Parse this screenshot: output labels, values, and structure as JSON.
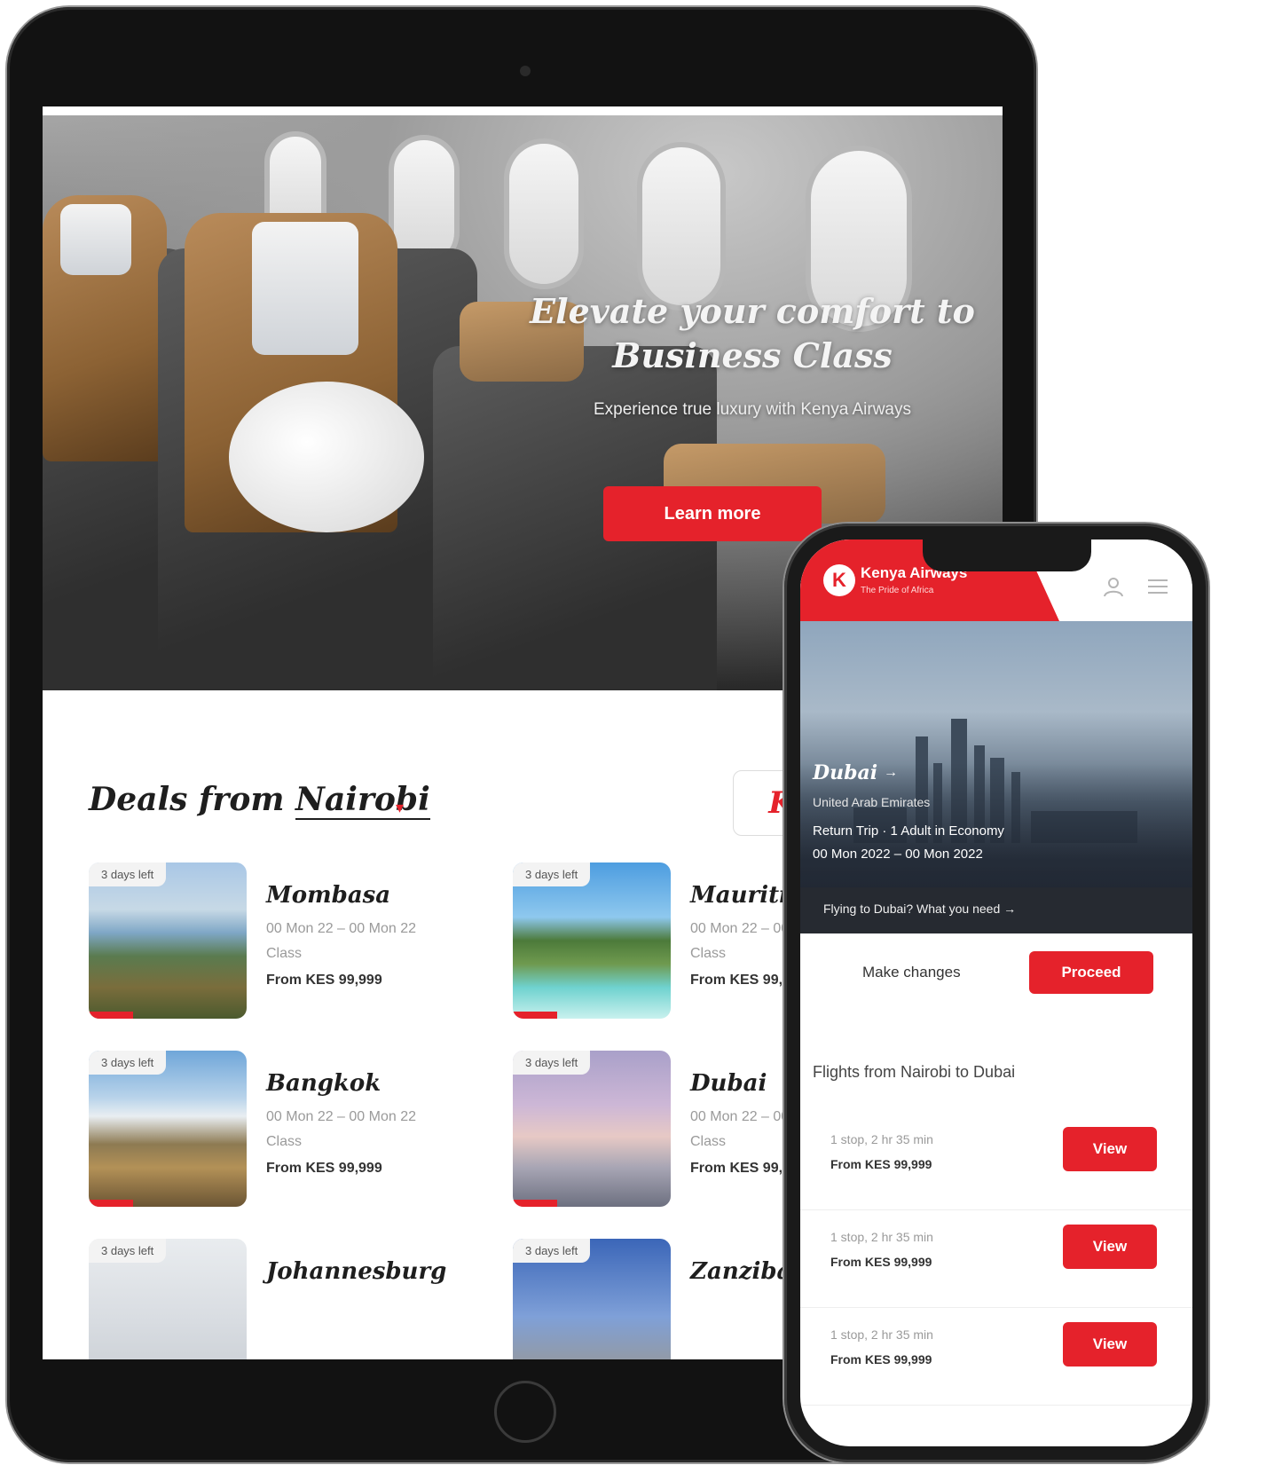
{
  "tablet": {
    "hero": {
      "title": "Elevate your comfort to Business Class",
      "subtitle": "Experience true luxury with Kenya Airways",
      "cta_label": "Learn more"
    },
    "deals": {
      "title_prefix": "Deals from",
      "city": "Nairobi",
      "caret": "▾",
      "badge": "K"
    },
    "deal_cards": [
      {
        "tag": "3 days left",
        "name": "Mombasa",
        "dates": "00 Mon 22 – 00 Mon 22",
        "class": "Class",
        "price": "From KES 99,999"
      },
      {
        "tag": "3 days left",
        "name": "Mauritius",
        "dates": "00 Mon 22 – 00 Mon 22",
        "class": "Class",
        "price": "From KES 99,999"
      },
      {
        "tag": "3 days left",
        "name": "Bangkok",
        "dates": "00 Mon 22 – 00 Mon 22",
        "class": "Class",
        "price": "From KES 99,999"
      },
      {
        "tag": "3 days left",
        "name": "Dubai",
        "dates": "00 Mon 22 – 00 Mon 22",
        "class": "Class",
        "price": "From KES 99,999"
      },
      {
        "tag": "3 days left",
        "name": "Johannesburg",
        "dates": "",
        "class": "",
        "price": ""
      },
      {
        "tag": "3 days left",
        "name": "Zanzibar",
        "dates": "",
        "class": "",
        "price": ""
      }
    ]
  },
  "phone": {
    "header": {
      "logo_letter": "K",
      "brand": "Kenya Airways",
      "tagline": "The Pride of Africa"
    },
    "hero": {
      "city": "Dubai",
      "city_arrow": "→",
      "country": "United Arab Emirates",
      "trip": "Return Trip · 1 Adult in Economy",
      "dates": "00 Mon 2022 – 00 Mon 2022",
      "strip": "Flying to Dubai? What you need →"
    },
    "actions": {
      "make_changes": "Make changes",
      "proceed": "Proceed"
    },
    "flights_heading": "Flights from Nairobi to Dubai",
    "flights": [
      {
        "stops": "1 stop, 2 hr 35 min",
        "price": "From KES 99,999",
        "button": "View"
      },
      {
        "stops": "1 stop, 2 hr 35 min",
        "price": "From KES 99,999",
        "button": "View"
      },
      {
        "stops": "1 stop, 2 hr 35 min",
        "price": "From KES 99,999",
        "button": "View"
      }
    ]
  },
  "colors": {
    "brand_red": "#e5222b",
    "text_dark": "#1e1e1e",
    "text_muted": "#9a9a9a"
  }
}
